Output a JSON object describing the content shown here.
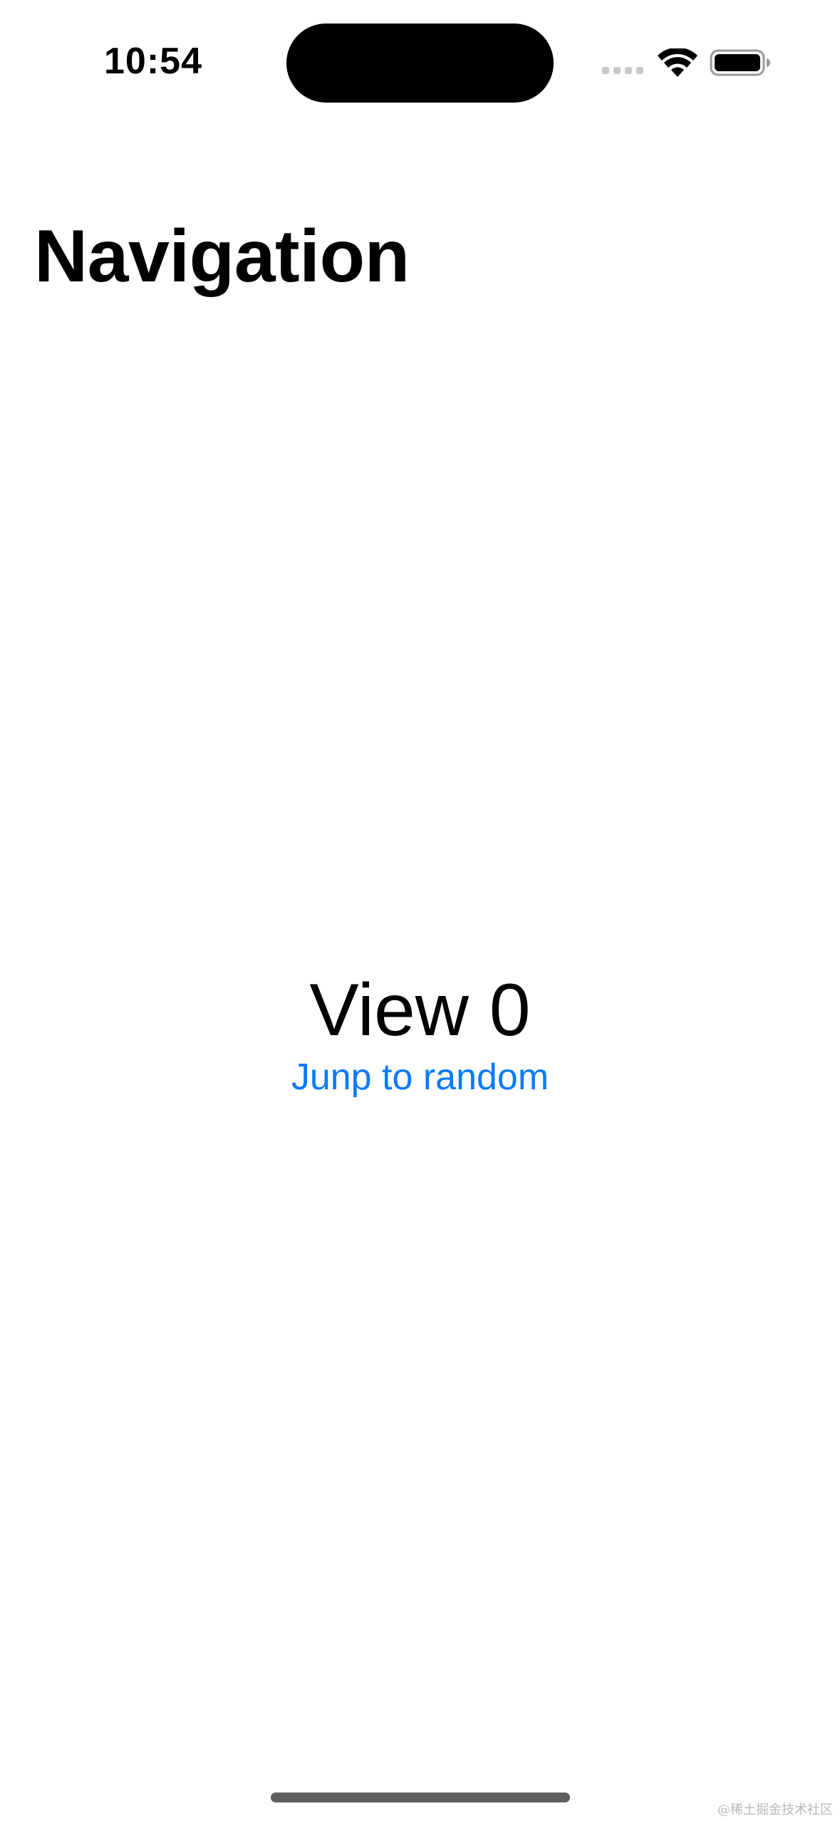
{
  "status_bar": {
    "time": "10:54",
    "icons": [
      "cellular-signal-icon",
      "wifi-icon",
      "battery-icon"
    ]
  },
  "navigation": {
    "title": "Navigation"
  },
  "content": {
    "view_label": "View 0",
    "jump_link_label": "Junp to random"
  },
  "watermark": "@稀土掘金技术社区",
  "colors": {
    "accent": "#0a7aff",
    "text": "#000000",
    "background": "#ffffff"
  }
}
